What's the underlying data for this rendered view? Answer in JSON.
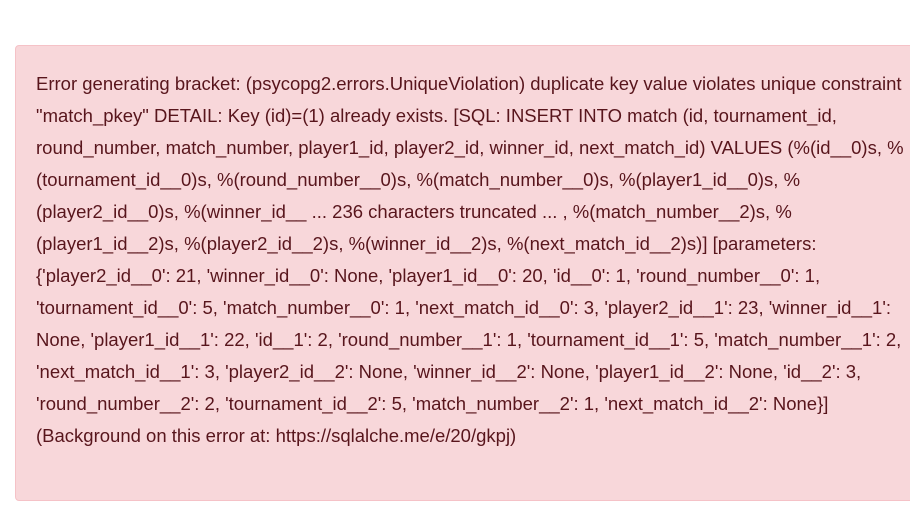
{
  "alert": {
    "type": "danger",
    "message": "Error generating bracket: (psycopg2.errors.UniqueViolation) duplicate key value violates unique constraint \"match_pkey\" DETAIL: Key (id)=(1) already exists. [SQL: INSERT INTO match (id, tournament_id, round_number, match_number, player1_id, player2_id, winner_id, next_match_id) VALUES (%(id__0)s, %(tournament_id__0)s, %(round_number__0)s, %(match_number__0)s, %(player1_id__0)s, %(player2_id__0)s, %(winner_id__ ... 236 characters truncated ... , %(match_number__2)s, %(player1_id__2)s, %(player2_id__2)s, %(winner_id__2)s, %(next_match_id__2)s)] [parameters: {'player2_id__0': 21, 'winner_id__0': None, 'player1_id__0': 20, 'id__0': 1, 'round_number__0': 1, 'tournament_id__0': 5, 'match_number__0': 1, 'next_match_id__0': 3, 'player2_id__1': 23, 'winner_id__1': None, 'player1_id__1': 22, 'id__1': 2, 'round_number__1': 1, 'tournament_id__1': 5, 'match_number__1': 2, 'next_match_id__1': 3, 'player2_id__2': None, 'winner_id__2': None, 'player1_id__2': None, 'id__2': 3, 'round_number__2': 2, 'tournament_id__2': 5, 'match_number__2': 1, 'next_match_id__2': None}] (Background on this error at: https://sqlalche.me/e/20/gkpj)",
    "colors": {
      "background": "#f8d7da",
      "border": "#f5c2c7",
      "text": "#58151c"
    }
  }
}
